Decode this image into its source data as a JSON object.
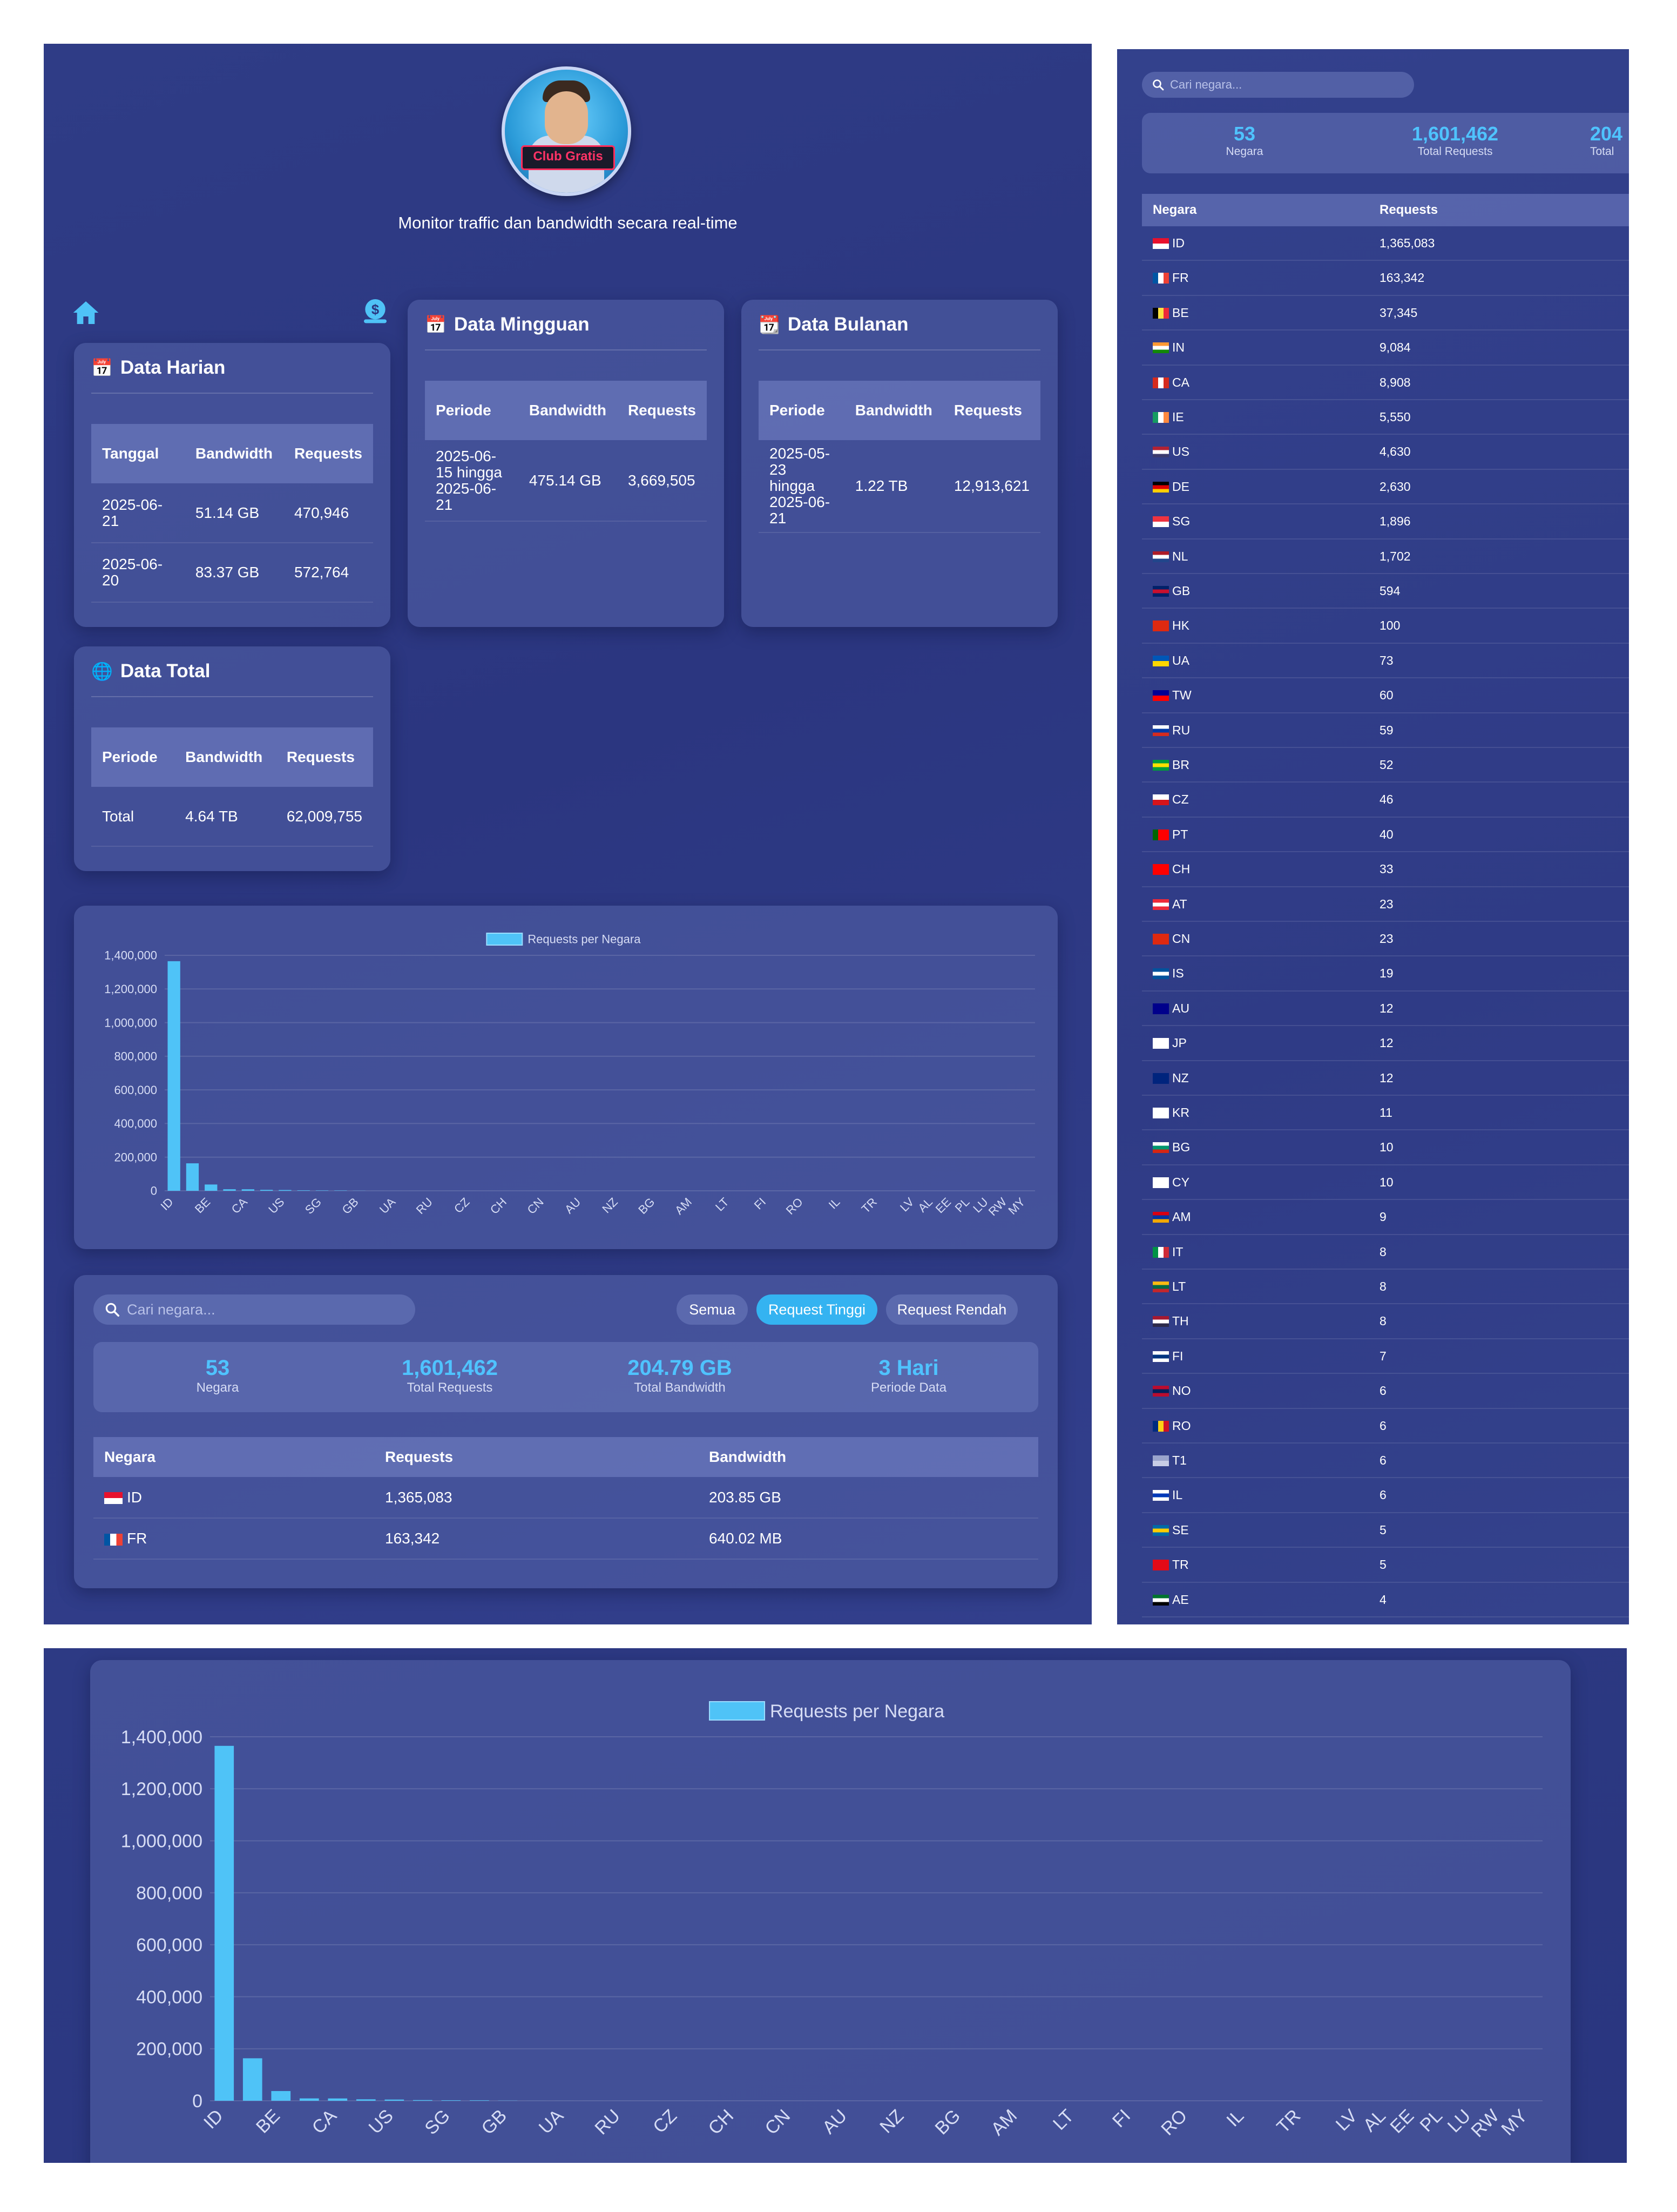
{
  "header": {
    "subtitle": "Monitor traffic dan bandwidth secara real-time",
    "logo_text": "Club Gratis"
  },
  "daily": {
    "title": "Data Harian",
    "headers": [
      "Tanggal",
      "Bandwidth",
      "Requests"
    ],
    "rows": [
      {
        "date": "2025-06-21",
        "bandwidth": "51.14 GB",
        "requests": "470,946"
      },
      {
        "date": "2025-06-20",
        "bandwidth": "83.37 GB",
        "requests": "572,764"
      }
    ]
  },
  "weekly": {
    "title": "Data Mingguan",
    "headers": [
      "Periode",
      "Bandwidth",
      "Requests"
    ],
    "rows": [
      {
        "period": "2025-06-15 hingga 2025-06-21",
        "bandwidth": "475.14 GB",
        "requests": "3,669,505"
      }
    ]
  },
  "monthly": {
    "title": "Data Bulanan",
    "headers": [
      "Periode",
      "Bandwidth",
      "Requests"
    ],
    "rows": [
      {
        "period": "2025-05-23 hingga 2025-06-21",
        "bandwidth": "1.22 TB",
        "requests": "12,913,621"
      }
    ]
  },
  "total": {
    "title": "Data Total",
    "headers": [
      "Periode",
      "Bandwidth",
      "Requests"
    ],
    "rows": [
      {
        "period": "Total",
        "bandwidth": "4.64 TB",
        "requests": "62,009,755"
      }
    ]
  },
  "search": {
    "placeholder": "Cari negara..."
  },
  "filters": [
    "Semua",
    "Request Tinggi",
    "Request Rendah"
  ],
  "filter_active": "Request Tinggi",
  "stats": [
    {
      "value": "53",
      "label": "Negara"
    },
    {
      "value": "1,601,462",
      "label": "Total Requests"
    },
    {
      "value": "204.79 GB",
      "label": "Total Bandwidth"
    },
    {
      "value": "3 Hari",
      "label": "Periode Data"
    }
  ],
  "side_stats_partial": {
    "value": "204",
    "label": "Total"
  },
  "country_table": {
    "headers": [
      "Negara",
      "Requests",
      "Bandwidth"
    ],
    "rows": [
      {
        "code": "ID",
        "requests": "1,365,083",
        "bandwidth": "203.85 GB"
      },
      {
        "code": "FR",
        "requests": "163,342",
        "bandwidth": "640.02 MB"
      }
    ]
  },
  "country_list": [
    {
      "code": "ID",
      "requests": "1,365,083",
      "flag": [
        "#e8112d",
        "#ffffff"
      ],
      "dir": "h"
    },
    {
      "code": "FR",
      "requests": "163,342",
      "flag": [
        "#0055a4",
        "#ffffff",
        "#ef4135"
      ],
      "dir": "v"
    },
    {
      "code": "BE",
      "requests": "37,345",
      "flag": [
        "#000000",
        "#fae042",
        "#ed2939"
      ],
      "dir": "v"
    },
    {
      "code": "IN",
      "requests": "9,084",
      "flag": [
        "#ff9933",
        "#ffffff",
        "#138808"
      ],
      "dir": "h"
    },
    {
      "code": "CA",
      "requests": "8,908",
      "flag": [
        "#d52b1e",
        "#ffffff",
        "#d52b1e"
      ],
      "dir": "v"
    },
    {
      "code": "IE",
      "requests": "5,550",
      "flag": [
        "#169b62",
        "#ffffff",
        "#ff883e"
      ],
      "dir": "v"
    },
    {
      "code": "US",
      "requests": "4,630",
      "flag": [
        "#b22234",
        "#ffffff",
        "#3c3b6e"
      ],
      "dir": "h"
    },
    {
      "code": "DE",
      "requests": "2,630",
      "flag": [
        "#000000",
        "#dd0000",
        "#ffce00"
      ],
      "dir": "h"
    },
    {
      "code": "SG",
      "requests": "1,896",
      "flag": [
        "#ef3340",
        "#ffffff"
      ],
      "dir": "h"
    },
    {
      "code": "NL",
      "requests": "1,702",
      "flag": [
        "#ae1c28",
        "#ffffff",
        "#21468b"
      ],
      "dir": "h"
    },
    {
      "code": "GB",
      "requests": "594",
      "flag": [
        "#012169",
        "#c8102e",
        "#012169"
      ],
      "dir": "h"
    },
    {
      "code": "HK",
      "requests": "100",
      "flag": [
        "#de2910",
        "#de2910"
      ],
      "dir": "h"
    },
    {
      "code": "UA",
      "requests": "73",
      "flag": [
        "#0057b7",
        "#ffd700"
      ],
      "dir": "h"
    },
    {
      "code": "TW",
      "requests": "60",
      "flag": [
        "#000095",
        "#fe0000"
      ],
      "dir": "h"
    },
    {
      "code": "RU",
      "requests": "59",
      "flag": [
        "#ffffff",
        "#0039a6",
        "#d52b1e"
      ],
      "dir": "h"
    },
    {
      "code": "BR",
      "requests": "52",
      "flag": [
        "#009c3b",
        "#ffdf00",
        "#009c3b"
      ],
      "dir": "h"
    },
    {
      "code": "CZ",
      "requests": "46",
      "flag": [
        "#ffffff",
        "#d7141a"
      ],
      "dir": "h"
    },
    {
      "code": "PT",
      "requests": "40",
      "flag": [
        "#006600",
        "#ff0000",
        "#ff0000"
      ],
      "dir": "v"
    },
    {
      "code": "CH",
      "requests": "33",
      "flag": [
        "#ff0000",
        "#ff0000"
      ],
      "dir": "h"
    },
    {
      "code": "AT",
      "requests": "23",
      "flag": [
        "#ed2939",
        "#ffffff",
        "#ed2939"
      ],
      "dir": "h"
    },
    {
      "code": "CN",
      "requests": "23",
      "flag": [
        "#de2910",
        "#de2910"
      ],
      "dir": "h"
    },
    {
      "code": "IS",
      "requests": "19",
      "flag": [
        "#02529c",
        "#ffffff",
        "#02529c"
      ],
      "dir": "h"
    },
    {
      "code": "AU",
      "requests": "12",
      "flag": [
        "#00008b",
        "#00008b"
      ],
      "dir": "h"
    },
    {
      "code": "JP",
      "requests": "12",
      "flag": [
        "#ffffff",
        "#ffffff"
      ],
      "dir": "h"
    },
    {
      "code": "NZ",
      "requests": "12",
      "flag": [
        "#00247d",
        "#00247d"
      ],
      "dir": "h"
    },
    {
      "code": "KR",
      "requests": "11",
      "flag": [
        "#ffffff",
        "#ffffff"
      ],
      "dir": "h"
    },
    {
      "code": "BG",
      "requests": "10",
      "flag": [
        "#ffffff",
        "#00966e",
        "#d62612"
      ],
      "dir": "h"
    },
    {
      "code": "CY",
      "requests": "10",
      "flag": [
        "#ffffff",
        "#ffffff"
      ],
      "dir": "h"
    },
    {
      "code": "AM",
      "requests": "9",
      "flag": [
        "#d90012",
        "#0033a0",
        "#f2a800"
      ],
      "dir": "h"
    },
    {
      "code": "IT",
      "requests": "8",
      "flag": [
        "#009246",
        "#ffffff",
        "#ce2b37"
      ],
      "dir": "v"
    },
    {
      "code": "LT",
      "requests": "8",
      "flag": [
        "#fdb913",
        "#006a44",
        "#c1272d"
      ],
      "dir": "h"
    },
    {
      "code": "TH",
      "requests": "8",
      "flag": [
        "#a51931",
        "#ffffff",
        "#2d2a4a"
      ],
      "dir": "h"
    },
    {
      "code": "FI",
      "requests": "7",
      "flag": [
        "#ffffff",
        "#003580",
        "#ffffff"
      ],
      "dir": "h"
    },
    {
      "code": "NO",
      "requests": "6",
      "flag": [
        "#ba0c2f",
        "#00205b",
        "#ba0c2f"
      ],
      "dir": "h"
    },
    {
      "code": "RO",
      "requests": "6",
      "flag": [
        "#002b7f",
        "#fcd116",
        "#ce1126"
      ],
      "dir": "v"
    },
    {
      "code": "T1",
      "requests": "6",
      "flag": [
        "#9aa4cc",
        "#c7cde6"
      ],
      "dir": "h"
    },
    {
      "code": "IL",
      "requests": "6",
      "flag": [
        "#ffffff",
        "#0038b8",
        "#ffffff"
      ],
      "dir": "h"
    },
    {
      "code": "SE",
      "requests": "5",
      "flag": [
        "#006aa7",
        "#fecc00",
        "#006aa7"
      ],
      "dir": "h"
    },
    {
      "code": "TR",
      "requests": "5",
      "flag": [
        "#e30a17",
        "#e30a17"
      ],
      "dir": "h"
    },
    {
      "code": "AE",
      "requests": "4",
      "flag": [
        "#00732f",
        "#ffffff",
        "#000000"
      ],
      "dir": "h"
    }
  ],
  "chart_data": {
    "type": "bar",
    "legend": "Requests per Negara",
    "legend_position": "top-center",
    "grid": true,
    "color": "#4fc3f7",
    "ylim": [
      0,
      1400000
    ],
    "yticks": [
      "1,400,000",
      "1,200,000",
      "1,000,000",
      "800,000",
      "600,000",
      "400,000",
      "200,000",
      "0"
    ],
    "categories": [
      "ID",
      "FR",
      "BE",
      "IN",
      "CA",
      "IE",
      "US",
      "DE",
      "SG",
      "NL",
      "GB",
      "HK",
      "UA",
      "TW",
      "RU",
      "BR",
      "CZ",
      "PT",
      "CH",
      "AT",
      "CN",
      "IS",
      "AU",
      "JP",
      "NZ",
      "KR",
      "BG",
      "CY",
      "AM",
      "IT",
      "LT",
      "TH",
      "FI",
      "NO",
      "RO",
      "T1",
      "IL",
      "SE",
      "TR",
      "AE",
      "LV",
      "AL",
      "EE",
      "PL",
      "LU",
      "RW",
      "MY"
    ],
    "values": [
      1365083,
      163342,
      37345,
      9084,
      8908,
      5550,
      4630,
      2630,
      1896,
      1702,
      594,
      100,
      73,
      60,
      59,
      52,
      46,
      40,
      33,
      23,
      23,
      19,
      12,
      12,
      12,
      11,
      10,
      10,
      9,
      8,
      8,
      8,
      7,
      6,
      6,
      6,
      6,
      5,
      5,
      4,
      4,
      3,
      3,
      2,
      2,
      1,
      1
    ],
    "shown_tick_labels": [
      "ID",
      "BE",
      "CA",
      "US",
      "SG",
      "GB",
      "UA",
      "RU",
      "CZ",
      "CH",
      "CN",
      "AU",
      "NZ",
      "BG",
      "AM",
      "LT",
      "FI",
      "RO",
      "IL",
      "TR",
      "LV",
      "AL",
      "EE",
      "PL",
      "LU",
      "RW",
      "MY"
    ]
  }
}
